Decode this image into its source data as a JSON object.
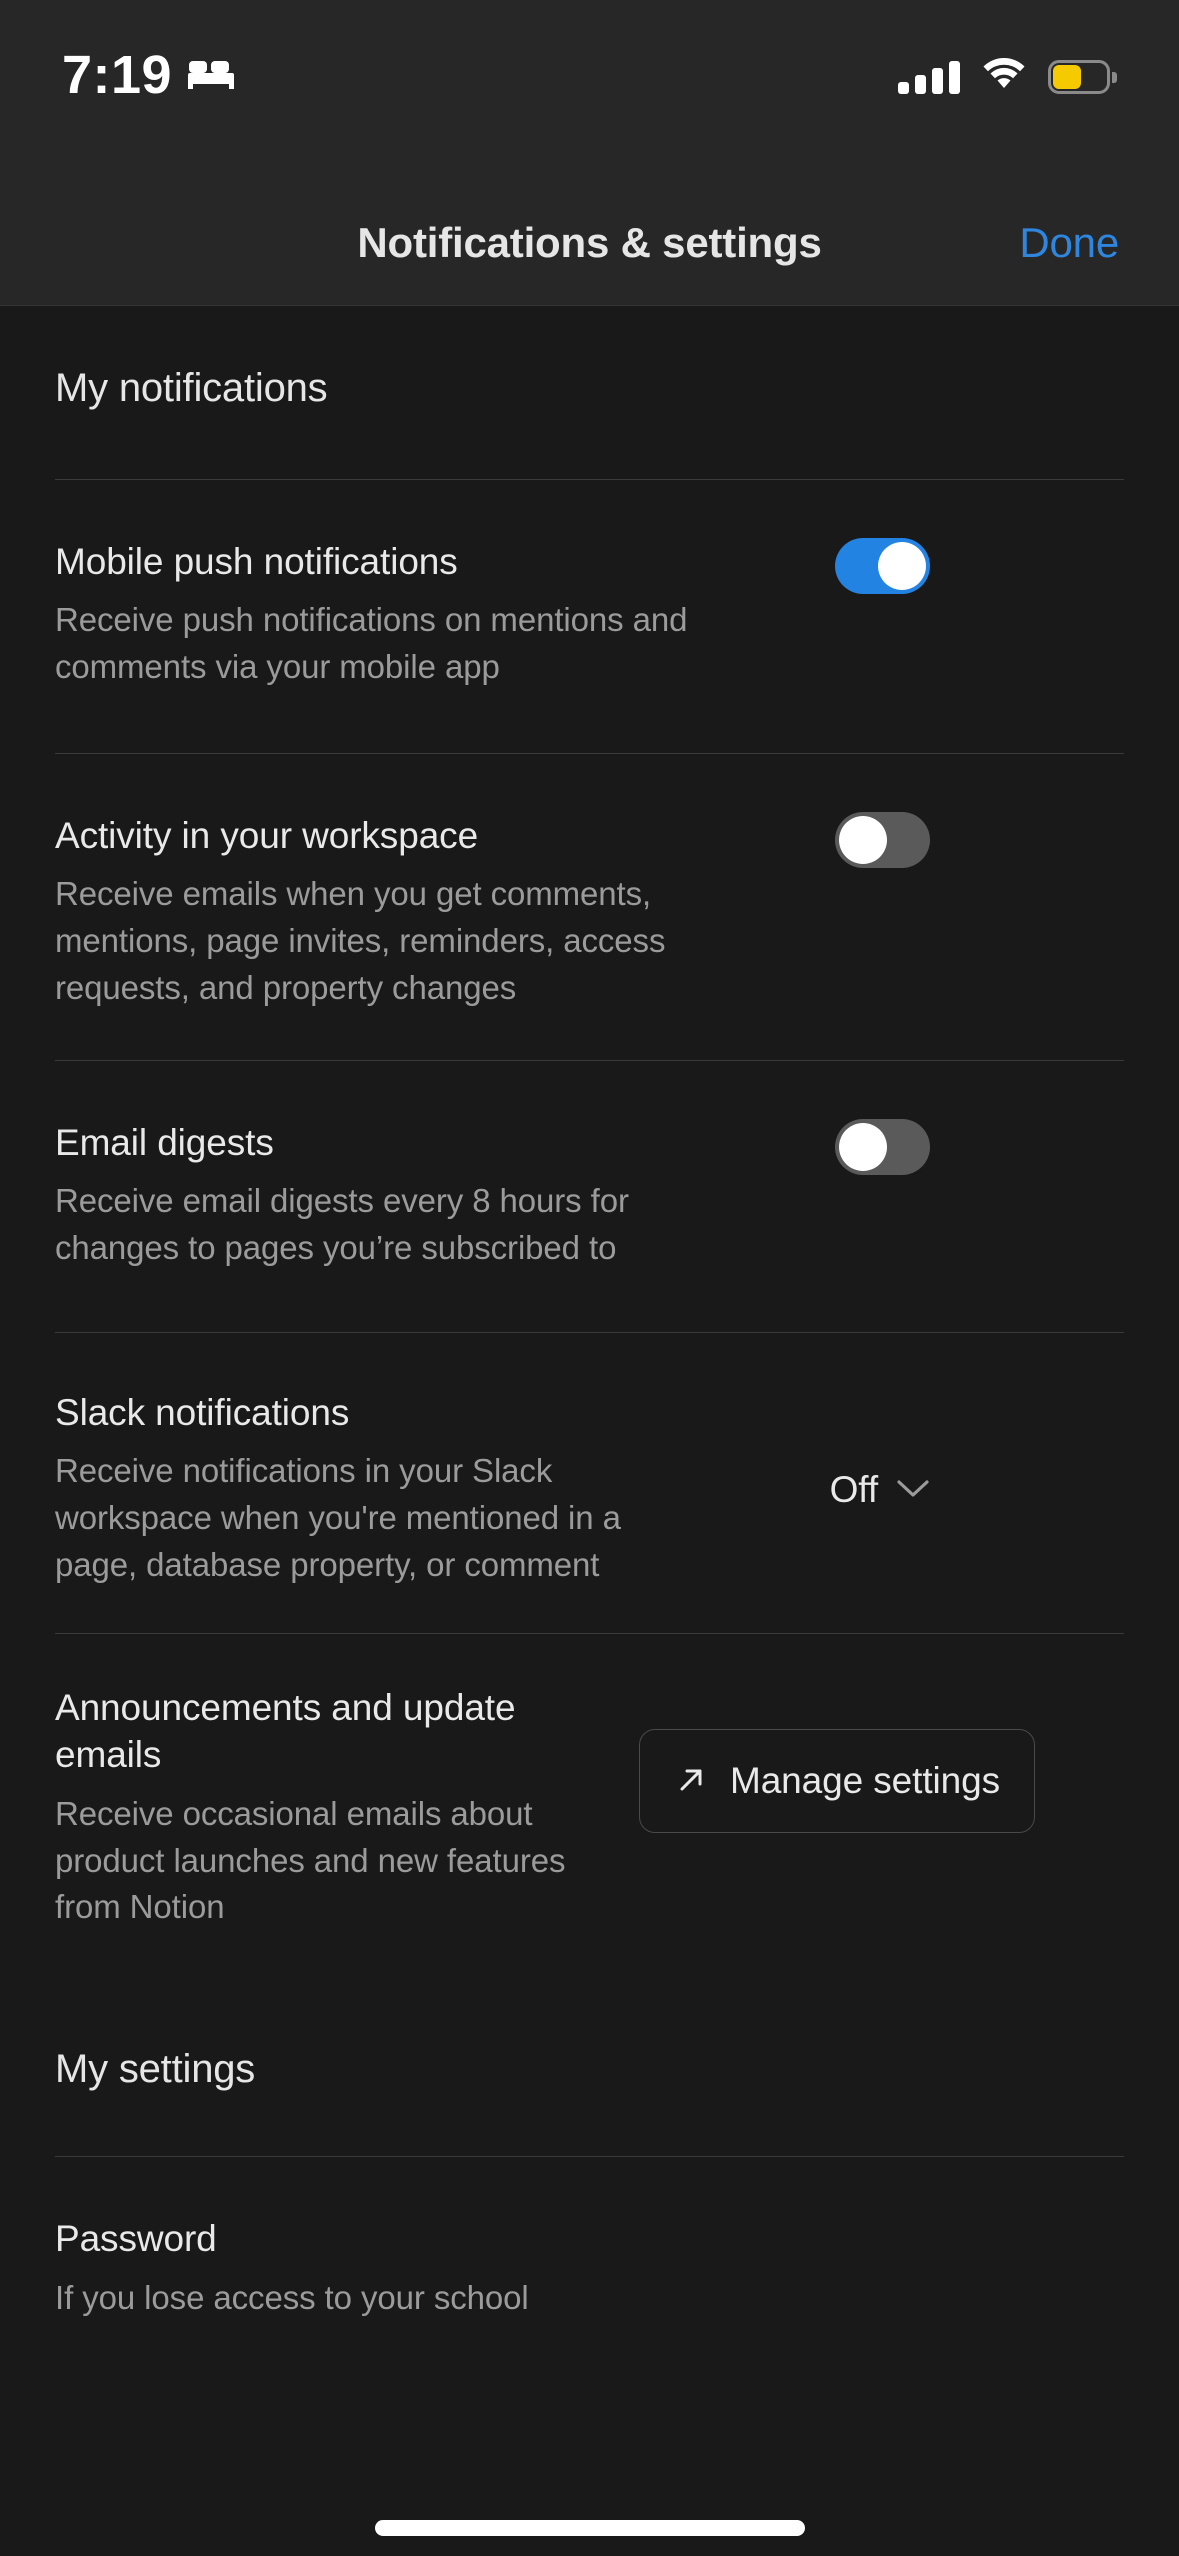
{
  "status_bar": {
    "time": "7:19",
    "focus_icon": "bed-icon",
    "cellular_icon": "cellular-signal-icon",
    "cellular_bars_filled": 4,
    "cellular_bars_total": 4,
    "wifi_icon": "wifi-icon",
    "battery_icon": "battery-icon",
    "battery_color": "#F5CB00",
    "battery_level_percent": 50
  },
  "header": {
    "title": "Notifications & settings",
    "done_label": "Done",
    "done_color": "#2E86DE"
  },
  "sections": [
    {
      "heading": "My notifications",
      "rows": [
        {
          "title": "Mobile push notifications",
          "description": "Receive push notifications on mentions and comments via your mobile app",
          "control": "toggle",
          "toggle_state": "on",
          "toggle_on_color": "#2383E2"
        },
        {
          "title": "Activity in your workspace",
          "description": "Receive emails when you get comments, mentions, page invites, reminders, access requests, and property changes",
          "control": "toggle",
          "toggle_state": "off",
          "toggle_off_color": "#5A5A5A"
        },
        {
          "title": "Email digests",
          "description": "Receive email digests every 8 hours for changes to pages you’re subscribed to",
          "control": "toggle",
          "toggle_state": "off",
          "toggle_off_color": "#5A5A5A"
        },
        {
          "title": "Slack notifications",
          "description": "Receive notifications in your Slack workspace when you're mentioned in a page, database property, or comment",
          "control": "select",
          "select_value": "Off",
          "select_icon": "chevron-down-icon"
        },
        {
          "title": "Announcements and update emails",
          "description": "Receive occasional emails about product launches and new features from Notion",
          "control": "button",
          "button_label": "Manage settings",
          "button_icon": "arrow-up-right-icon"
        }
      ]
    },
    {
      "heading": "My settings",
      "rows": [
        {
          "title": "Password",
          "description": "If you lose access to your school",
          "control": "none"
        }
      ]
    }
  ]
}
